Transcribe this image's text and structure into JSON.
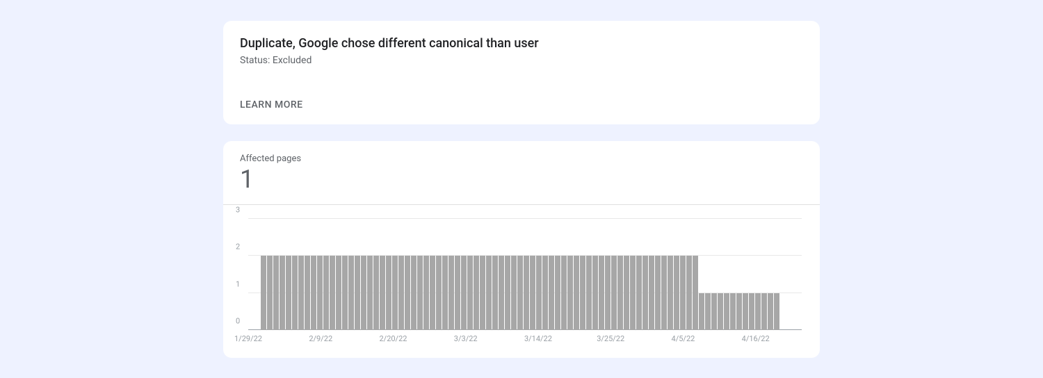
{
  "header": {
    "title": "Duplicate, Google chose different canonical than user",
    "status_label": "Status: ",
    "status_value": "Excluded",
    "learn_more": "LEARN MORE"
  },
  "affected": {
    "label": "Affected pages",
    "value": "1"
  },
  "chart_data": {
    "type": "bar",
    "title": "",
    "xlabel": "",
    "ylabel": "",
    "ylim": [
      0,
      3
    ],
    "y_ticks": [
      0,
      1,
      2,
      3
    ],
    "x_tick_labels": [
      "1/29/22",
      "2/9/22",
      "2/20/22",
      "3/3/22",
      "3/14/22",
      "3/25/22",
      "4/5/22",
      "4/16/22"
    ],
    "categories": [
      "1/29/22",
      "1/30/22",
      "1/31/22",
      "2/1/22",
      "2/2/22",
      "2/3/22",
      "2/4/22",
      "2/5/22",
      "2/6/22",
      "2/7/22",
      "2/8/22",
      "2/9/22",
      "2/10/22",
      "2/11/22",
      "2/12/22",
      "2/13/22",
      "2/14/22",
      "2/15/22",
      "2/16/22",
      "2/17/22",
      "2/18/22",
      "2/19/22",
      "2/20/22",
      "2/21/22",
      "2/22/22",
      "2/23/22",
      "2/24/22",
      "2/25/22",
      "2/26/22",
      "2/27/22",
      "2/28/22",
      "3/1/22",
      "3/2/22",
      "3/3/22",
      "3/4/22",
      "3/5/22",
      "3/6/22",
      "3/7/22",
      "3/8/22",
      "3/9/22",
      "3/10/22",
      "3/11/22",
      "3/12/22",
      "3/13/22",
      "3/14/22",
      "3/15/22",
      "3/16/22",
      "3/17/22",
      "3/18/22",
      "3/19/22",
      "3/20/22",
      "3/21/22",
      "3/22/22",
      "3/23/22",
      "3/24/22",
      "3/25/22",
      "3/26/22",
      "3/27/22",
      "3/28/22",
      "3/29/22",
      "3/30/22",
      "3/31/22",
      "4/1/22",
      "4/2/22",
      "4/3/22",
      "4/4/22",
      "4/5/22",
      "4/6/22",
      "4/7/22",
      "4/8/22",
      "4/9/22",
      "4/10/22",
      "4/11/22",
      "4/12/22",
      "4/13/22",
      "4/14/22",
      "4/15/22",
      "4/16/22",
      "4/17/22",
      "4/18/22",
      "4/19/22",
      "4/20/22",
      "4/21/22",
      "4/22/22",
      "4/23/22"
    ],
    "values": [
      0,
      0,
      2,
      2,
      2,
      2,
      2,
      2,
      2,
      2,
      2,
      2,
      2,
      2,
      2,
      2,
      2,
      2,
      2,
      2,
      2,
      2,
      2,
      2,
      2,
      2,
      2,
      2,
      2,
      2,
      2,
      2,
      2,
      2,
      2,
      2,
      2,
      2,
      2,
      2,
      2,
      2,
      2,
      2,
      2,
      2,
      2,
      2,
      2,
      2,
      2,
      2,
      2,
      2,
      2,
      2,
      2,
      2,
      2,
      2,
      2,
      2,
      2,
      2,
      2,
      2,
      2,
      2,
      2,
      2,
      2,
      2,
      1,
      1,
      1,
      1,
      1,
      1,
      1,
      1,
      1,
      1,
      1,
      1,
      1
    ]
  }
}
